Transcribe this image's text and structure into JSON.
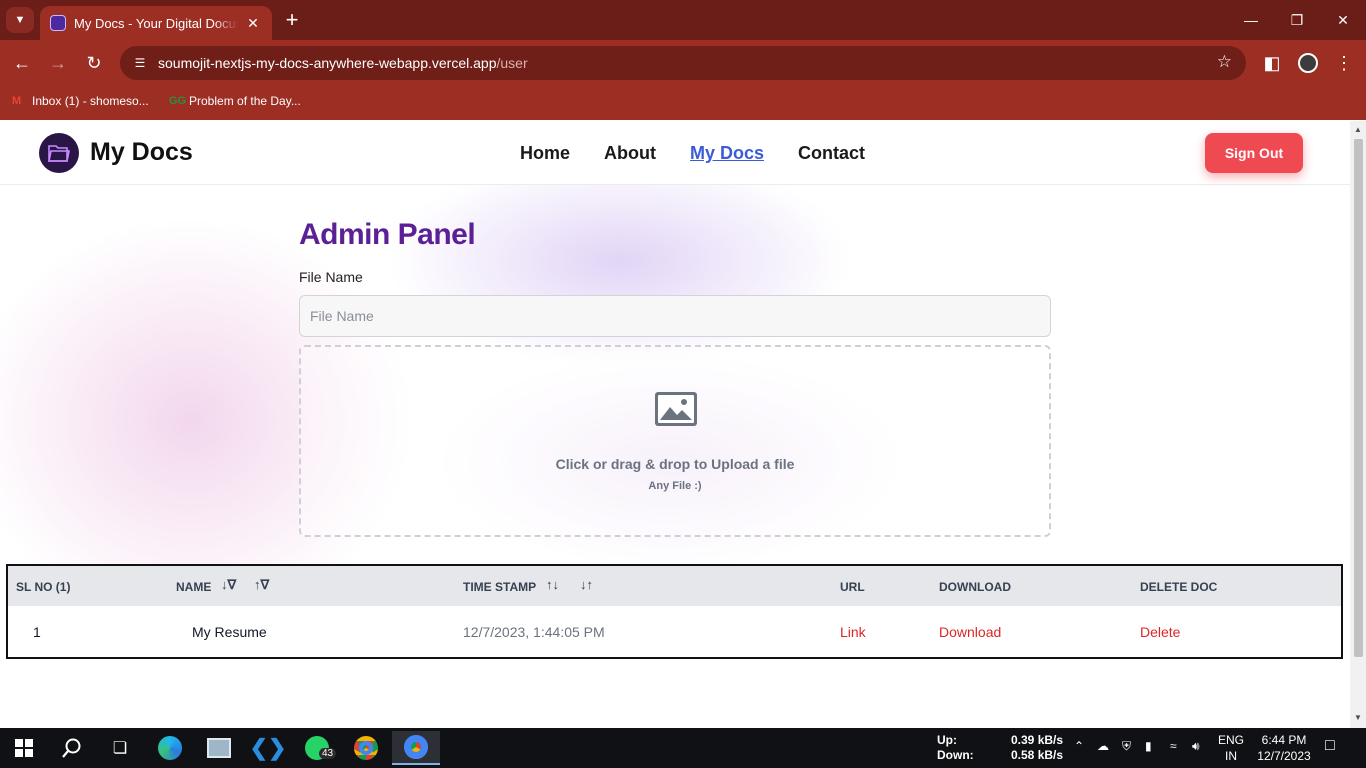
{
  "browser": {
    "tab_title": "My Docs - Your Digital Documents",
    "url_host": "soumojit-nextjs-my-docs-anywhere-webapp.vercel.app",
    "url_path": "/user",
    "bookmarks": [
      {
        "label": "Inbox (1) - shomeso..."
      },
      {
        "label": "Problem of the Day..."
      }
    ]
  },
  "navbar": {
    "brand": "My Docs",
    "links": [
      {
        "label": "Home"
      },
      {
        "label": "About"
      },
      {
        "label": "My Docs"
      },
      {
        "label": "Contact"
      }
    ],
    "signout_label": "Sign Out",
    "active_link": "My Docs"
  },
  "admin": {
    "title": "Admin Panel",
    "file_label": "File Name",
    "file_placeholder": "File Name",
    "file_value": "",
    "upload_main": "Click or drag & drop to Upload a file",
    "upload_sub": "Any File :)"
  },
  "table": {
    "headers": {
      "sl": "SL NO (1)",
      "name": "NAME",
      "timestamp": "TIME STAMP",
      "url": "URL",
      "download": "DOWNLOAD",
      "delete": "DELETE DOC"
    },
    "rows": [
      {
        "sl": "1",
        "name": "My Resume",
        "timestamp": "12/7/2023, 1:44:05 PM",
        "url": "Link",
        "download": "Download",
        "delete": "Delete"
      }
    ]
  },
  "taskbar": {
    "whatsapp_badge": "43",
    "net_up_label": "Up:",
    "net_down_label": "Down:",
    "net_up": "0.39 kB/s",
    "net_down": "0.58 kB/s",
    "lang": "ENG",
    "region": "IN",
    "time": "6:44 PM",
    "date": "12/7/2023"
  },
  "colors": {
    "chrome_frame": "#6b1d17",
    "chrome_toolbar": "#9c2e24",
    "title_purple": "#5b1f96",
    "active_link": "#3b5bd9",
    "signout_red": "#ef4a52",
    "action_red": "#dc2626"
  }
}
